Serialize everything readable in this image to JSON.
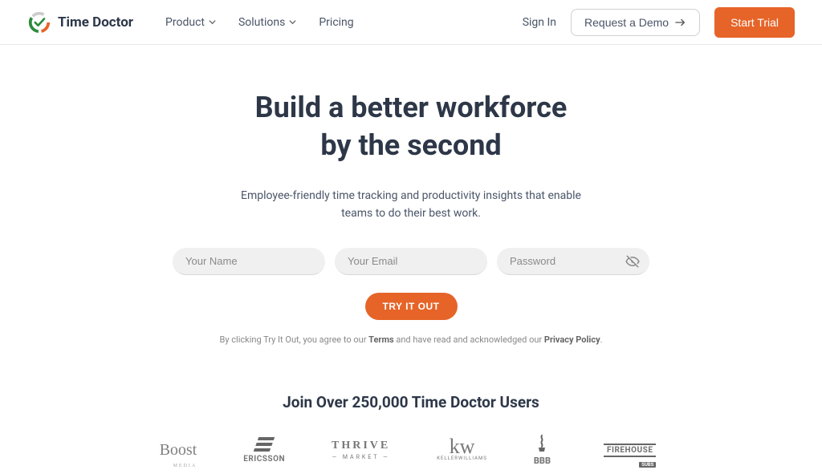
{
  "brand": {
    "name": "Time Doctor"
  },
  "nav": {
    "items": [
      {
        "label": "Product",
        "has_dropdown": true
      },
      {
        "label": "Solutions",
        "has_dropdown": true
      },
      {
        "label": "Pricing",
        "has_dropdown": false
      }
    ],
    "signin": "Sign In",
    "demo_btn": "Request a Demo",
    "trial_btn": "Start Trial"
  },
  "hero": {
    "title_line1": "Build a better workforce",
    "title_line2": "by the second",
    "subtitle_line1": "Employee-friendly time tracking and productivity insights that enable",
    "subtitle_line2": "teams to do their best work."
  },
  "form": {
    "name_placeholder": "Your Name",
    "email_placeholder": "Your Email",
    "password_placeholder": "Password",
    "submit": "TRY IT OUT"
  },
  "consent": {
    "prefix": "By clicking Try It Out, you agree to our ",
    "terms": "Terms",
    "middle": "  and have read and acknowledged our ",
    "privacy": "Privacy Policy",
    "suffix": "."
  },
  "users": {
    "heading": "Join Over 250,000 Time Doctor Users",
    "logos": {
      "boost": "Boost",
      "boost_sub": "MEDIA",
      "ericsson": "ERICSSON",
      "thrive_main": "THRIVE",
      "thrive_sub": "— MARKET —",
      "kw_main": "kw",
      "kw_sub": "KELLERWILLIAMS",
      "bbb": "BBB",
      "firehouse_main": "FIREHOUSE",
      "firehouse_sub": "SUBS"
    }
  }
}
